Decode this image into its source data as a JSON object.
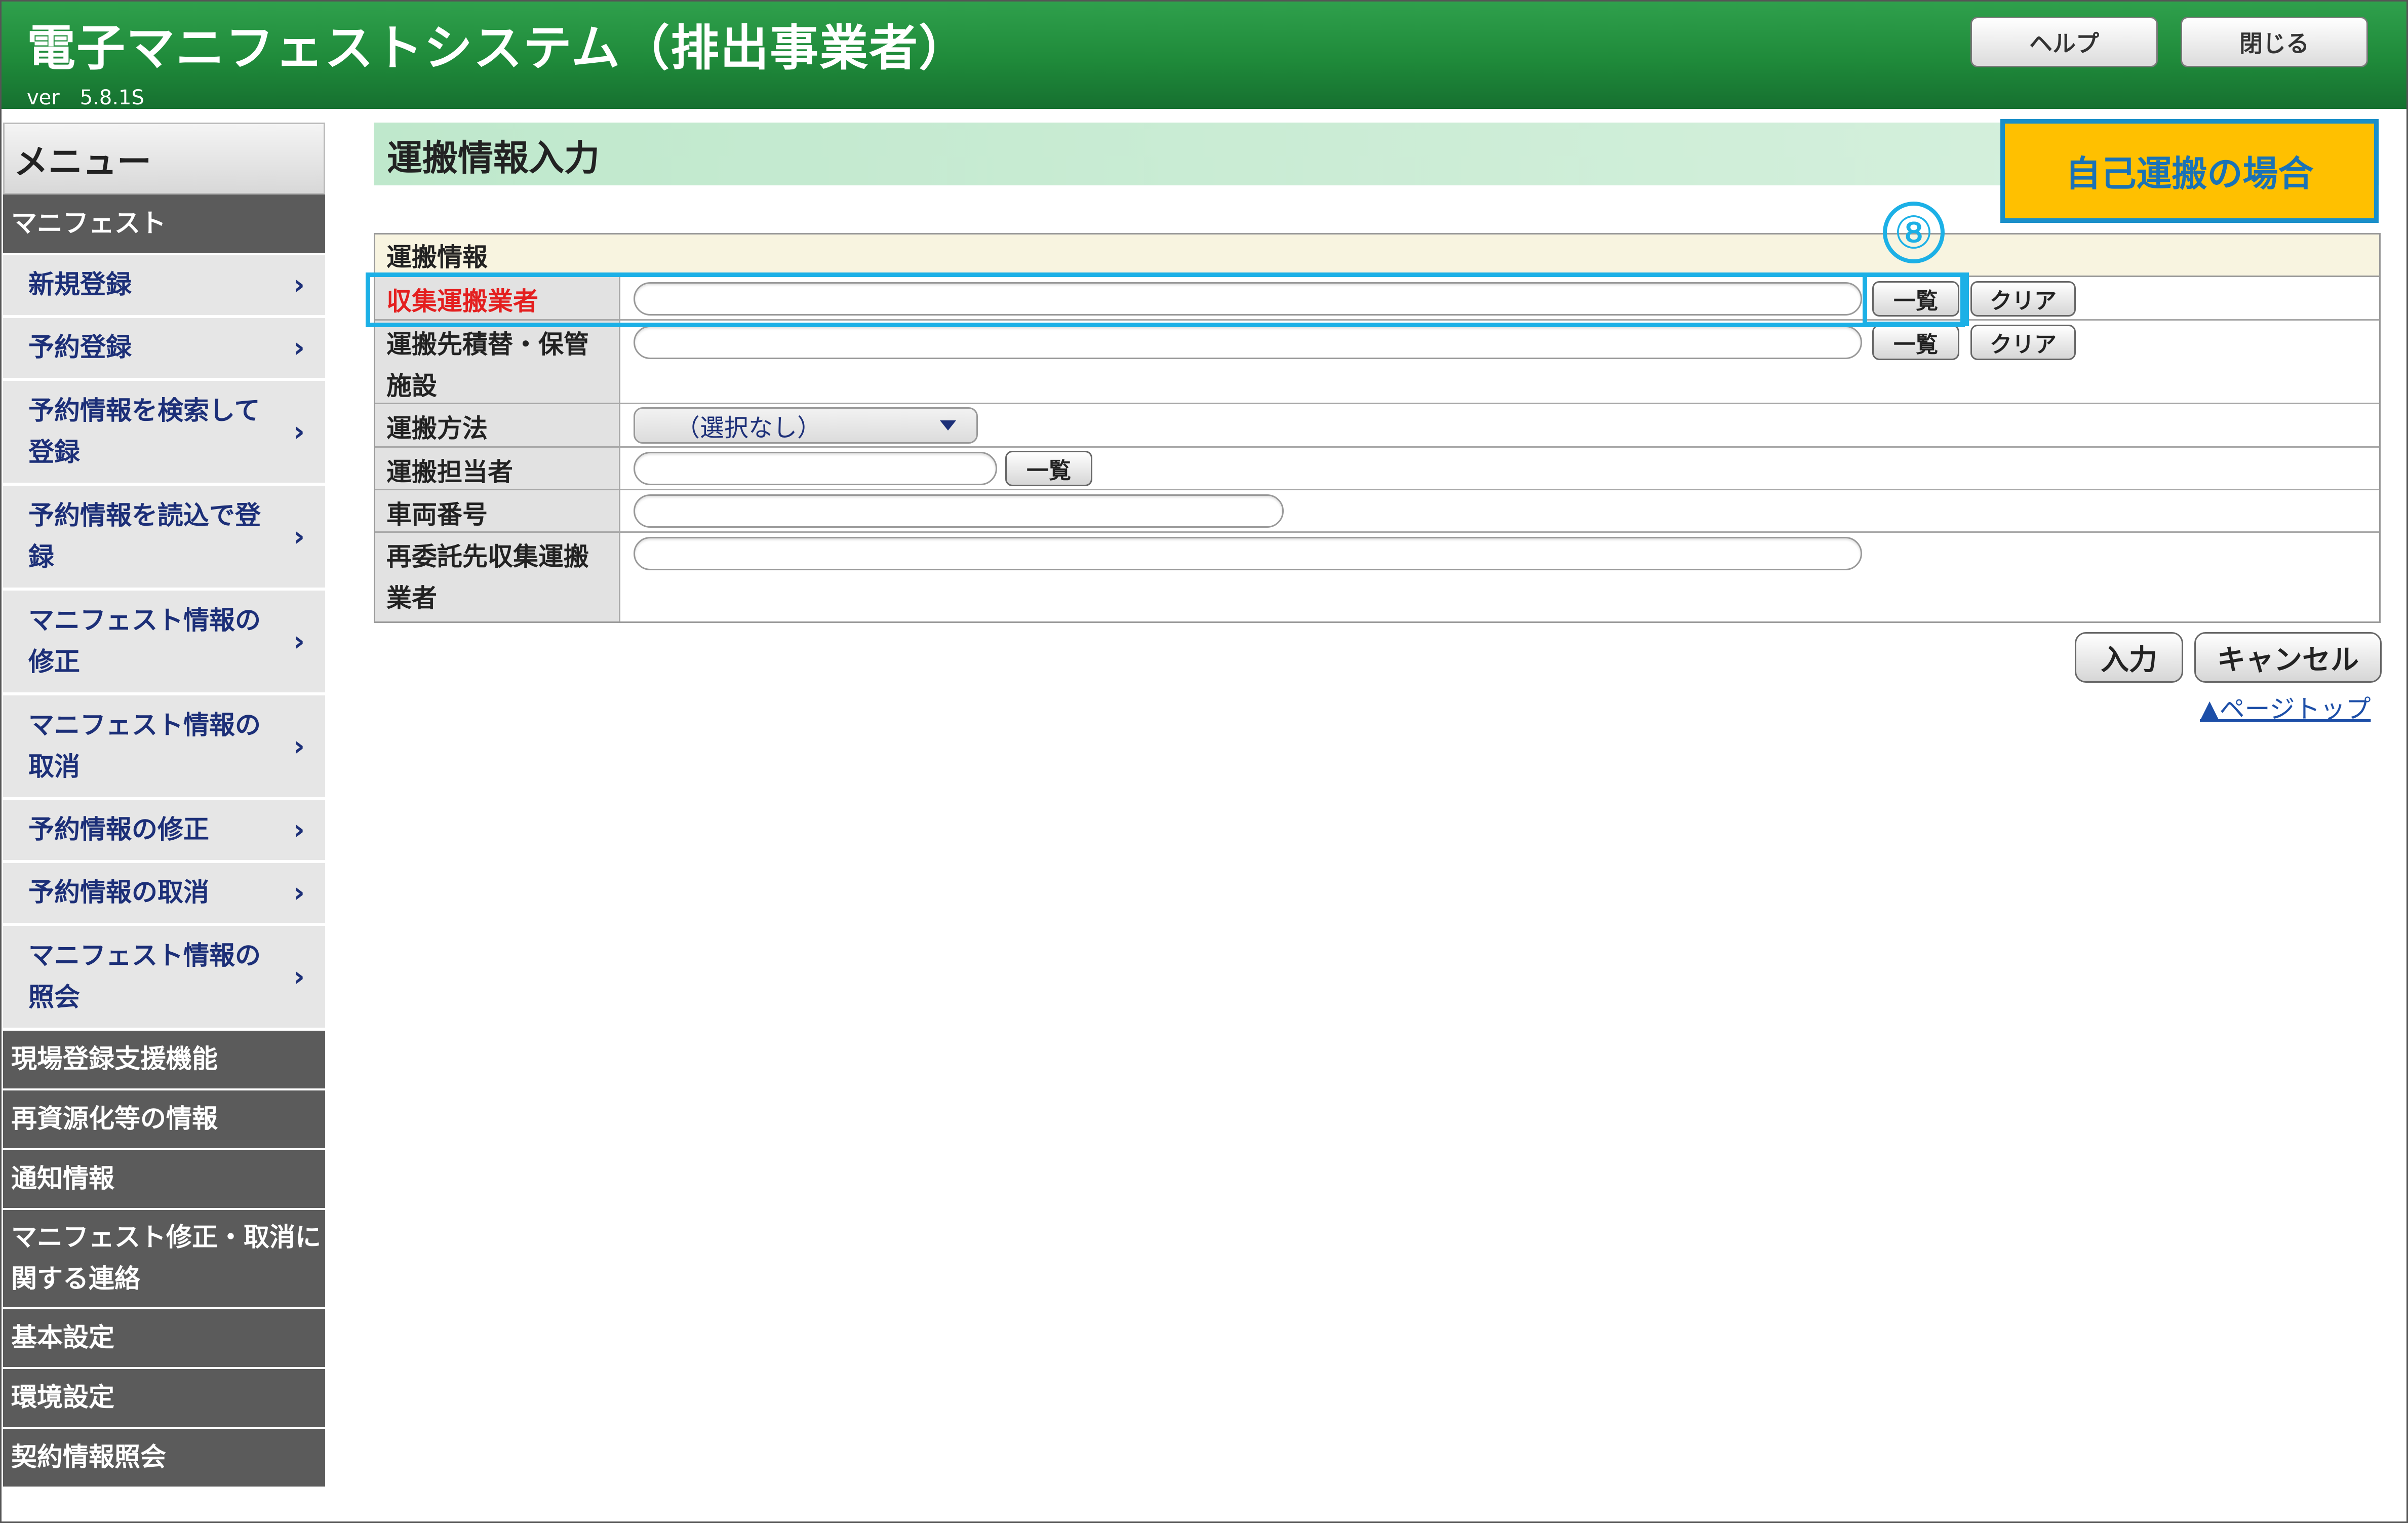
{
  "app": {
    "title": "電子マニフェストシステム（排出事業者）",
    "version": "ver　5.8.1S",
    "help_label": "ヘルプ",
    "close_label": "閉じる"
  },
  "sidebar": {
    "menu_label": "メニュー",
    "section_manifest": "マニフェスト",
    "manifest_items": [
      {
        "label": "新規登録"
      },
      {
        "label": "予約登録"
      },
      {
        "label": "予約情報を検索して登録"
      },
      {
        "label": "予約情報を読込で登録"
      },
      {
        "label": "マニフェスト情報の修正"
      },
      {
        "label": "マニフェスト情報の取消"
      },
      {
        "label": "予約情報の修正"
      },
      {
        "label": "予約情報の取消"
      },
      {
        "label": "マニフェスト情報の照会"
      }
    ],
    "sections": [
      {
        "label": "現場登録支援機能"
      },
      {
        "label": "再資源化等の情報"
      },
      {
        "label": "通知情報"
      },
      {
        "label": "マニフェスト修正・取消に関する連絡"
      },
      {
        "label": "基本設定"
      },
      {
        "label": "環境設定"
      },
      {
        "label": "契約情報照会"
      }
    ],
    "chevron_glyph": "›"
  },
  "main": {
    "page_title": "運搬情報入力",
    "callout": "自己運搬の場合",
    "step_marker": "⑧",
    "form": {
      "header": "運搬情報",
      "collector_label": "収集運搬業者",
      "collector_value": "",
      "destination_label": "運搬先積替・保管施設",
      "destination_value": "",
      "method_label": "運搬方法",
      "method_selected": "（選択なし）",
      "person_label": "運搬担当者",
      "person_value": "",
      "vehicle_label": "車両番号",
      "vehicle_value": "",
      "subcontract_label": "再委託先収集運搬業者",
      "subcontract_value": "",
      "list_button": "一覧",
      "clear_button": "クリア"
    },
    "submit_label": "入力",
    "cancel_label": "キャンセル",
    "page_top_link": "▲ページトップ"
  },
  "colors": {
    "header_green": "#1f8a3a",
    "sidebar_dark": "#5b5b5b",
    "sidebar_item_text": "#1c2f78",
    "required_label": "#e41f1f",
    "highlight_blue": "#1cb0e6",
    "callout_yellow": "#ffc000"
  },
  "icons": [
    "chevron-right-icon",
    "dropdown-arrow-icon"
  ]
}
